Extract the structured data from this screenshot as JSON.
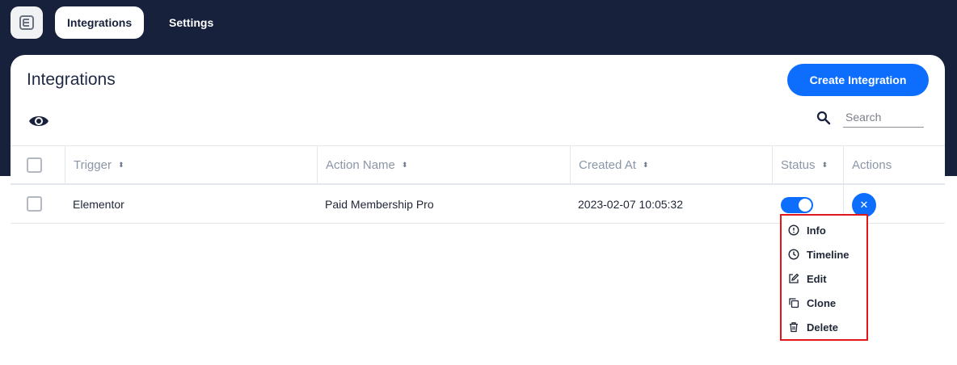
{
  "nav": {
    "tabs": [
      {
        "label": "Integrations",
        "active": true
      },
      {
        "label": "Settings",
        "active": false
      }
    ]
  },
  "page": {
    "title": "Integrations",
    "create_button": "Create Integration",
    "search_placeholder": "Search"
  },
  "table": {
    "columns": [
      "Trigger",
      "Action Name",
      "Created At",
      "Status",
      "Actions"
    ],
    "rows": [
      {
        "trigger": "Elementor",
        "action_name": "Paid Membership Pro",
        "created_at": "2023-02-07 10:05:32",
        "status_on": true
      }
    ]
  },
  "actions_menu": {
    "items": [
      {
        "label": "Info",
        "icon": "info-icon"
      },
      {
        "label": "Timeline",
        "icon": "clock-icon"
      },
      {
        "label": "Edit",
        "icon": "edit-icon"
      },
      {
        "label": "Clone",
        "icon": "clone-icon"
      },
      {
        "label": "Delete",
        "icon": "trash-icon"
      }
    ],
    "close_glyph": "✕"
  },
  "colors": {
    "topbar": "#17213b",
    "primary": "#0d6efd",
    "highlight": "#e0161b"
  }
}
